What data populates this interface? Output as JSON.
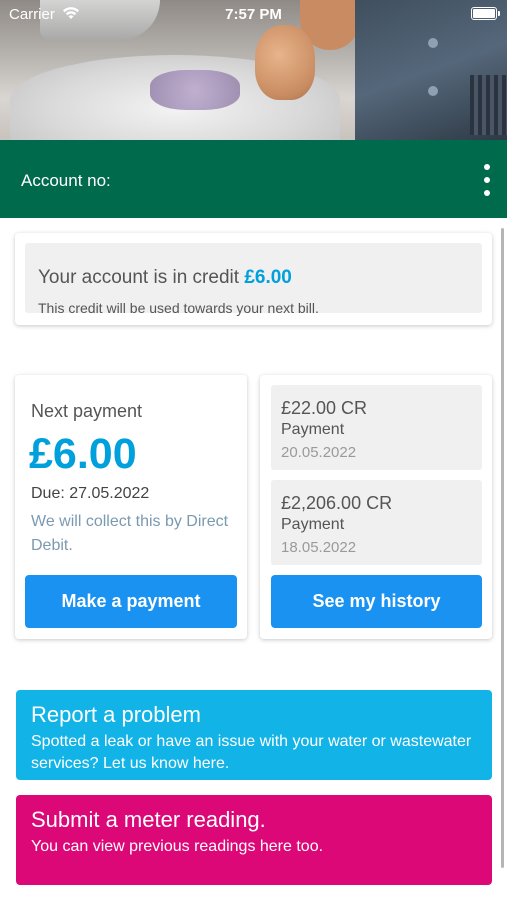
{
  "status_bar": {
    "carrier": "Carrier",
    "time": "7:57 PM"
  },
  "header": {
    "account_label": "Account no:",
    "menu_icon": "more-vertical-icon"
  },
  "credit": {
    "text": "Your account is in credit",
    "amount": "£6.00",
    "note": "This credit will be used towards your next bill."
  },
  "next_payment": {
    "label": "Next payment",
    "amount": "£6.00",
    "due": "Due: 27.05.2022",
    "collect": "We will collect this by Direct Debit.",
    "button": "Make a payment"
  },
  "history": {
    "items": [
      {
        "amount": "£22.00 CR",
        "type": "Payment",
        "date": "20.05.2022"
      },
      {
        "amount": "£2,206.00 CR",
        "type": "Payment",
        "date": "18.05.2022"
      }
    ],
    "button": "See my history"
  },
  "report": {
    "title": "Report a problem",
    "text": "Spotted a leak or have an issue with your water or wastewater services? Let us know here."
  },
  "meter": {
    "title": "Submit a meter reading.",
    "text": "You can view previous readings here too."
  },
  "colors": {
    "header_green": "#006a4d",
    "accent_blue": "#00a0dc",
    "button_blue": "#1a92f2",
    "report_blue": "#12b4e8",
    "meter_pink": "#dd0877"
  }
}
